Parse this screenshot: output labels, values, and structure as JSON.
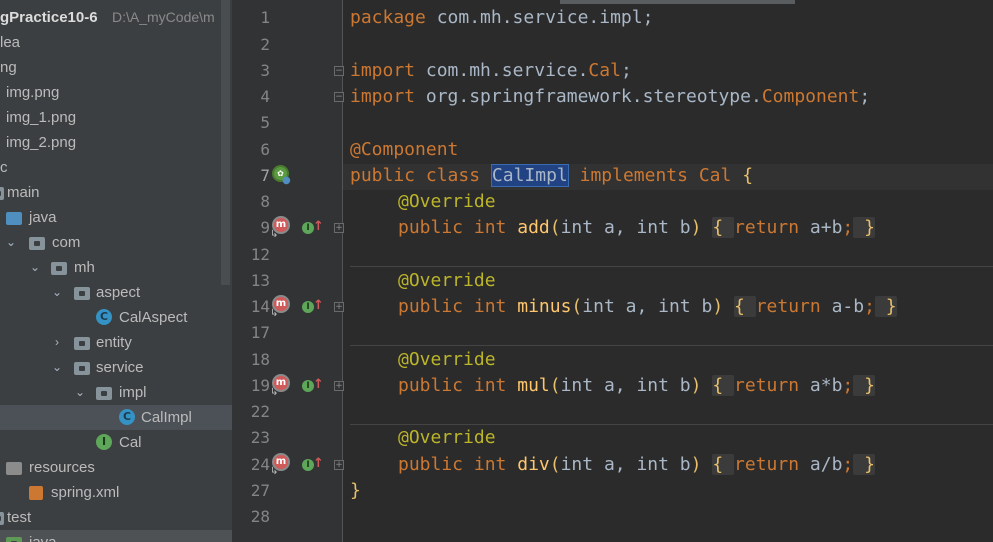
{
  "project": {
    "name": "gPractice10-6",
    "path": "D:\\A_myCode\\m"
  },
  "tree": {
    "idea": "lea",
    "img_folder": "ng",
    "img1": "img.png",
    "img2": "img_1.png",
    "img3": "img_2.png",
    "src": "c",
    "main": "main",
    "java": "java",
    "com": "com",
    "mh": "mh",
    "aspect": "aspect",
    "calaspect": "CalAspect",
    "entity": "entity",
    "service": "service",
    "impl": "impl",
    "calimpl": "CalImpl",
    "cal": "Cal",
    "resources": "resources",
    "springxml": "spring.xml",
    "test": "test",
    "java2": "java"
  },
  "editor": {
    "line_numbers": [
      "1",
      "2",
      "3",
      "4",
      "5",
      "6",
      "7",
      "8",
      "9",
      "12",
      "13",
      "14",
      "17",
      "18",
      "19",
      "22",
      "23",
      "24",
      "27",
      "28"
    ],
    "current_line": "7",
    "l1_kw": "package",
    "l1_rest": " com.mh.service.impl;",
    "l3_kw": "import",
    "l3_pkg": " com.mh.service.",
    "l3_cls": "Cal",
    "l3_end": ";",
    "l4_kw": "import",
    "l4_pkg": " org.springframework.stereotype.",
    "l4_cls": "Component",
    "l4_end": ";",
    "l6_ann": "@Component",
    "l7_public": "public",
    "l7_class": "class",
    "l7_name": "CalImpl",
    "l7_impl": "implements",
    "l7_iface": "Cal",
    "l7_brace": "{",
    "override": "@Override",
    "public": "public",
    "int": "int",
    "m_add": "add",
    "m_minus": "minus",
    "m_mul": "mul",
    "m_div": "div",
    "params_open": "(",
    "params": "int a, int b",
    "params_close": ")",
    "ob": "{",
    "ret": "return",
    "e_add": "a+b",
    "e_minus": "a-b",
    "e_mul": "a*b",
    "e_div": "a/b",
    "semi": ";",
    "cb": "}",
    "close_class": "}"
  },
  "icons": {
    "class": "C",
    "interface": "I",
    "method_override": "m",
    "bean": "spring-bean-icon"
  }
}
